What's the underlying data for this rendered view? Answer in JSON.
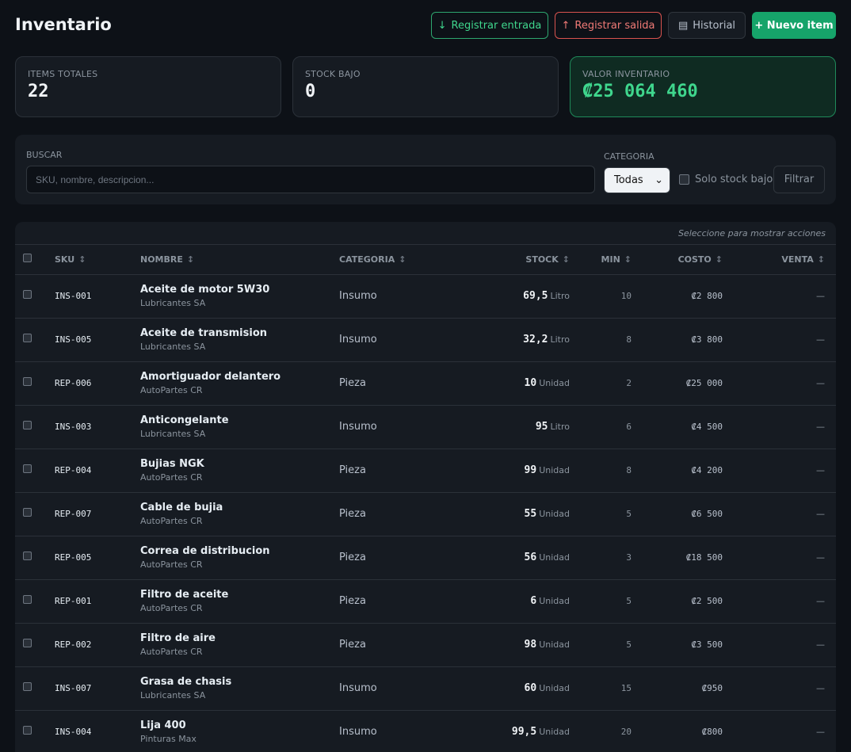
{
  "header": {
    "title": "Inventario",
    "btn_entry": "Registrar entrada",
    "btn_exit": "Registrar salida",
    "btn_history": "Historial",
    "btn_new": "+ Nuevo item",
    "entry_icon": "↓",
    "exit_icon": "↑",
    "history_icon": "▤"
  },
  "stats": {
    "total_label": "ITEMS TOTALES",
    "total_value": "22",
    "low_label": "STOCK BAJO",
    "low_value": "0",
    "value_label": "VALOR INVENTARIO",
    "value_value": "₡25 064 460"
  },
  "filters": {
    "search_label": "BUSCAR",
    "search_placeholder": "SKU, nombre, descripcion...",
    "category_label": "CATEGORIA",
    "category_selected": "Todas",
    "low_stock_label": "Solo stock bajo",
    "filter_button": "Filtrar"
  },
  "table": {
    "hint": "Seleccione para mostrar acciones",
    "columns": {
      "sku": "SKU",
      "name": "NOMBRE",
      "category": "CATEGORIA",
      "stock": "STOCK",
      "min": "MIN",
      "cost": "COSTO",
      "sale": "VENTA"
    },
    "rows": [
      {
        "sku": "INS-001",
        "name": "Aceite de motor 5W30",
        "supplier": "Lubricantes SA",
        "category": "Insumo",
        "stock": "69,5",
        "unit": "Litro",
        "min": "10",
        "cost": "₡2 800",
        "sale": "—"
      },
      {
        "sku": "INS-005",
        "name": "Aceite de transmision",
        "supplier": "Lubricantes SA",
        "category": "Insumo",
        "stock": "32,2",
        "unit": "Litro",
        "min": "8",
        "cost": "₡3 800",
        "sale": "—"
      },
      {
        "sku": "REP-006",
        "name": "Amortiguador delantero",
        "supplier": "AutoPartes CR",
        "category": "Pieza",
        "stock": "10",
        "unit": "Unidad",
        "min": "2",
        "cost": "₡25 000",
        "sale": "—"
      },
      {
        "sku": "INS-003",
        "name": "Anticongelante",
        "supplier": "Lubricantes SA",
        "category": "Insumo",
        "stock": "95",
        "unit": "Litro",
        "min": "6",
        "cost": "₡4 500",
        "sale": "—"
      },
      {
        "sku": "REP-004",
        "name": "Bujias NGK",
        "supplier": "AutoPartes CR",
        "category": "Pieza",
        "stock": "99",
        "unit": "Unidad",
        "min": "8",
        "cost": "₡4 200",
        "sale": "—"
      },
      {
        "sku": "REP-007",
        "name": "Cable de bujia",
        "supplier": "AutoPartes CR",
        "category": "Pieza",
        "stock": "55",
        "unit": "Unidad",
        "min": "5",
        "cost": "₡6 500",
        "sale": "—"
      },
      {
        "sku": "REP-005",
        "name": "Correa de distribucion",
        "supplier": "AutoPartes CR",
        "category": "Pieza",
        "stock": "56",
        "unit": "Unidad",
        "min": "3",
        "cost": "₡18 500",
        "sale": "—"
      },
      {
        "sku": "REP-001",
        "name": "Filtro de aceite",
        "supplier": "AutoPartes CR",
        "category": "Pieza",
        "stock": "6",
        "unit": "Unidad",
        "min": "5",
        "cost": "₡2 500",
        "sale": "—"
      },
      {
        "sku": "REP-002",
        "name": "Filtro de aire",
        "supplier": "AutoPartes CR",
        "category": "Pieza",
        "stock": "98",
        "unit": "Unidad",
        "min": "5",
        "cost": "₡3 500",
        "sale": "—"
      },
      {
        "sku": "INS-007",
        "name": "Grasa de chasis",
        "supplier": "Lubricantes SA",
        "category": "Insumo",
        "stock": "60",
        "unit": "Unidad",
        "min": "15",
        "cost": "₡950",
        "sale": "—"
      },
      {
        "sku": "INS-004",
        "name": "Lija 400",
        "supplier": "Pinturas Max",
        "category": "Insumo",
        "stock": "99,5",
        "unit": "Unidad",
        "min": "20",
        "cost": "₡800",
        "sale": "—"
      }
    ]
  }
}
